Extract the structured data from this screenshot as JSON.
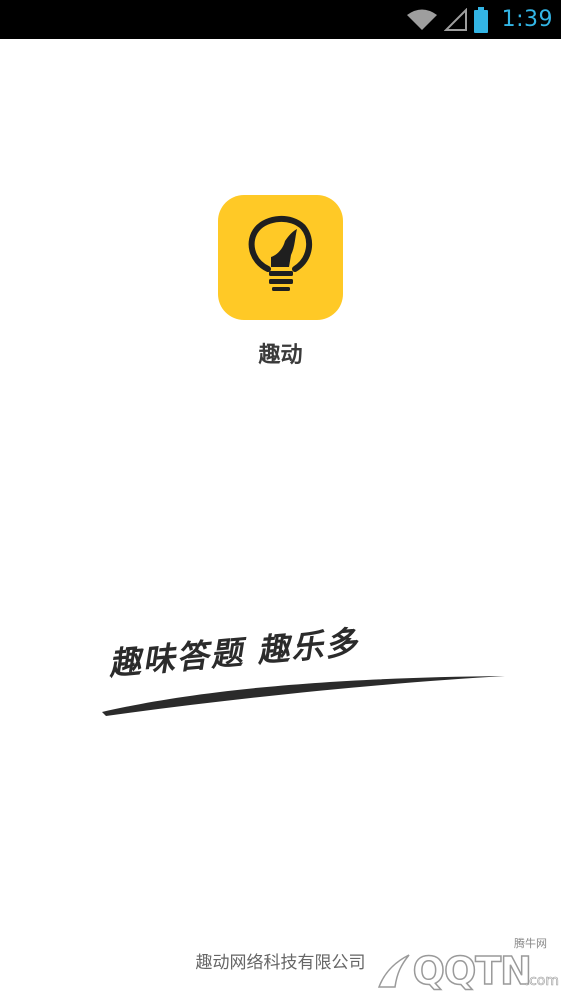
{
  "status_bar": {
    "time": "1:39",
    "icons": [
      "wifi-icon",
      "signal-icon",
      "battery-icon"
    ],
    "accent_color": "#33b5e5"
  },
  "app": {
    "name": "趣动",
    "logo_icon": "lightbulb-icon",
    "logo_color": "#ffc926"
  },
  "slogan": {
    "text": "趣味答题 趣乐多"
  },
  "footer": {
    "company": "趣动网络科技有限公司"
  },
  "watermark": {
    "logo_text": "QQTN",
    "suffix": ".com",
    "cn_label": "腾牛网"
  }
}
